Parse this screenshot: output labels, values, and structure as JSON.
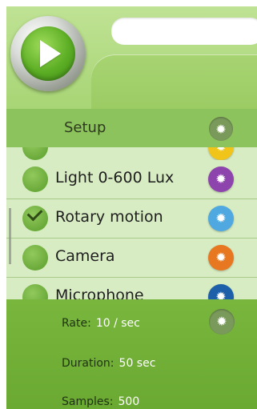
{
  "header": {
    "search": {
      "value": "",
      "placeholder": ""
    },
    "play_icon": "play-icon"
  },
  "setup": {
    "title": "Setup",
    "gear_icon": "gear-icon"
  },
  "sensors": [
    {
      "label": "",
      "checked": false,
      "gear_color": "#f0c419"
    },
    {
      "label": "Light 0-600 Lux",
      "checked": false,
      "gear_color": "#8e44ad"
    },
    {
      "label": "Rotary motion",
      "checked": true,
      "gear_color": "#4fa8e0"
    },
    {
      "label": "Camera",
      "checked": false,
      "gear_color": "#e87722"
    },
    {
      "label": "Microphone",
      "checked": false,
      "gear_color": "#1d5fa8"
    }
  ],
  "settings": {
    "rate_label": "Rate:",
    "rate_value": "10 / sec",
    "duration_label": "Duration:",
    "duration_value": "50 sec",
    "samples_label": "Samples:",
    "samples_value": "500"
  },
  "colors": {
    "header_bg": "#a8d575",
    "setup_bar": "#8dc35c",
    "list_bg": "#d7ecc2",
    "bottom_bg": "#6aa932"
  }
}
